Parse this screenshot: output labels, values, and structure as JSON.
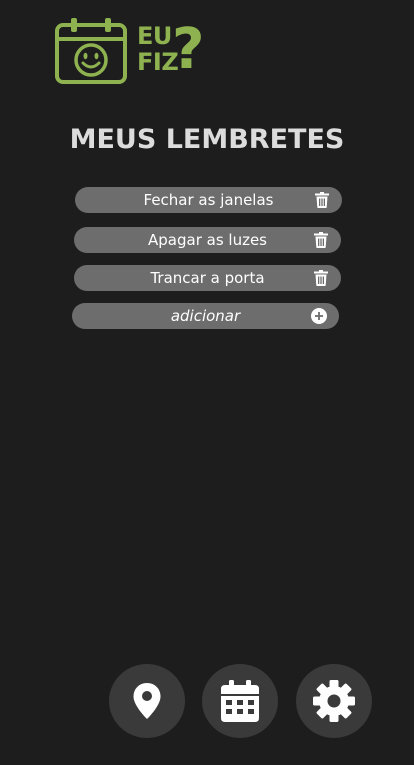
{
  "logo": {
    "line1": "EU",
    "line2": "FIZ",
    "question_mark": "?",
    "color": "#8fb250"
  },
  "title": "MEUS LEMBRETES",
  "reminders": [
    {
      "label": "Fechar as janelas",
      "icon": "trash-icon"
    },
    {
      "label": "Apagar as luzes",
      "icon": "trash-icon"
    },
    {
      "label": "Trancar a porta",
      "icon": "trash-icon"
    }
  ],
  "add_item": {
    "label": "adicionar",
    "icon": "plus-circle-icon"
  },
  "nav": [
    {
      "icon": "map-pin-icon"
    },
    {
      "icon": "calendar-icon"
    },
    {
      "icon": "gear-icon"
    }
  ],
  "colors": {
    "background": "#1d1d1d",
    "pill": "#6d6d6d",
    "nav_button": "#3a3a3a",
    "accent": "#8fb250"
  }
}
